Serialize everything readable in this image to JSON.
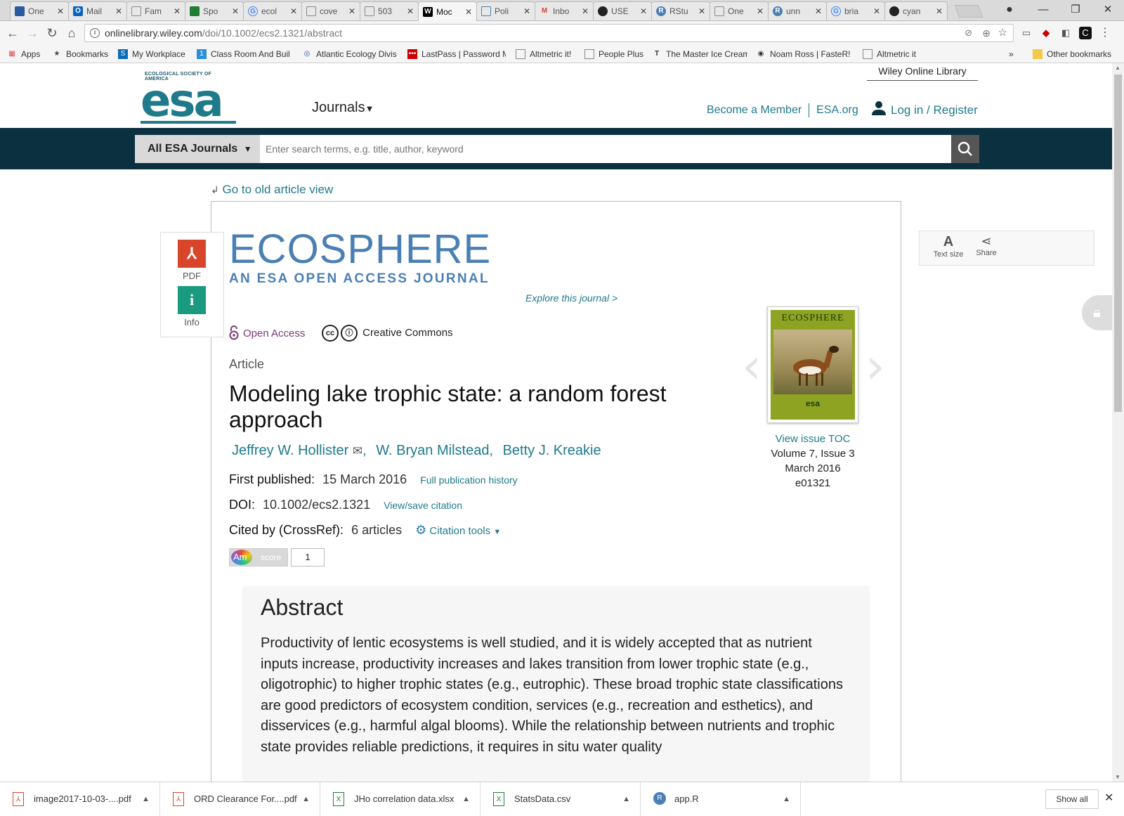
{
  "browser": {
    "tabs": [
      {
        "label": "One",
        "icon": "onedrive-icon",
        "color": "#2a5b9e"
      },
      {
        "label": "Mail",
        "icon": "outlook-icon",
        "color": "#0a64c2"
      },
      {
        "label": "Fam",
        "icon": "page-icon",
        "color": "#888888"
      },
      {
        "label": "Spo",
        "icon": "sheets-icon",
        "color": "#1e7e34"
      },
      {
        "label": "ecol",
        "icon": "google-icon",
        "color": "#4285f4"
      },
      {
        "label": "cove",
        "icon": "page-icon",
        "color": "#888888"
      },
      {
        "label": "503",
        "icon": "page-icon",
        "color": "#888888"
      },
      {
        "label": "Moc",
        "icon": "wiley-icon",
        "color": "#000000"
      },
      {
        "label": "Poli",
        "icon": "doc-icon",
        "color": "#4a7fb5"
      },
      {
        "label": "Inbo",
        "icon": "gmail-icon",
        "color": "#d44638"
      },
      {
        "label": "USE",
        "icon": "github-icon",
        "color": "#222222"
      },
      {
        "label": "RStu",
        "icon": "rstudio-icon",
        "color": "#4a7fb5"
      },
      {
        "label": "One",
        "icon": "page-icon",
        "color": "#888888"
      },
      {
        "label": "unn",
        "icon": "rstudio-icon",
        "color": "#4a7fb5"
      },
      {
        "label": "bria",
        "icon": "google-icon",
        "color": "#4285f4"
      },
      {
        "label": "cyan",
        "icon": "github-icon",
        "color": "#222222"
      }
    ],
    "tab_close": "✕",
    "window_controls": {
      "minimize": "—",
      "restore": "❐",
      "close": "✕"
    },
    "url_host": "onlinelibrary.wiley.com",
    "url_path": "/doi/10.1002/ecs2.1321/abstract",
    "bookmarks": [
      {
        "label": "Apps",
        "icon": "apps-grid-icon"
      },
      {
        "label": "Bookmarks",
        "icon": "star-icon"
      },
      {
        "label": "My Workplace",
        "icon": "sharepoint-icon"
      },
      {
        "label": "Class Room And Buil",
        "icon": "classroom-icon"
      },
      {
        "label": "Atlantic Ecology Divis",
        "icon": "epa-icon"
      },
      {
        "label": "LastPass | Password M",
        "icon": "lastpass-icon"
      },
      {
        "label": "Altmetric it!",
        "icon": "page-icon"
      },
      {
        "label": "People Plus",
        "icon": "page-icon"
      },
      {
        "label": "The Master Ice Cream",
        "icon": "nyt-icon"
      },
      {
        "label": "Noam Ross | FasteR!",
        "icon": "circle-icon"
      },
      {
        "label": "Altmetric it",
        "icon": "page-icon"
      }
    ],
    "bookmarks_overflow": "»",
    "other_bookmarks": "Other bookmarks"
  },
  "site": {
    "esa_small": "ECOLOGICAL SOCIETY OF AMERICA",
    "esa_logo": "esa",
    "wiley_link": "Wiley Online Library",
    "journals_menu": "Journals",
    "become_member": "Become a Member",
    "esa_org": "ESA.org",
    "login": "Log in / Register",
    "search_scope": "All ESA Journals",
    "search_placeholder": "Enter search terms, e.g. title, author, keyword",
    "colors": {
      "brand": "#1f7a8c",
      "dark_bar": "#0b3040",
      "journal_blue": "#4a7fb5",
      "open_access": "#7a3a78"
    }
  },
  "article": {
    "old_view": "Go to old article view",
    "tools": {
      "pdf": "PDF",
      "info": "Info",
      "text_size": "Text size",
      "share": "Share"
    },
    "journal_title": "ECOSPHERE",
    "journal_subtitle": "AN ESA OPEN ACCESS JOURNAL",
    "explore": "Explore this journal >",
    "open_access": "Open Access",
    "license": "Creative Commons",
    "type": "Article",
    "title": "Modeling lake trophic state: a random forest approach",
    "authors": [
      "Jeffrey W. Hollister",
      "W. Bryan Milstead,",
      "Betty J. Kreakie"
    ],
    "first_published_label": "First published:",
    "first_published": "15 March 2016",
    "pub_history": "Full publication history",
    "doi_label": "DOI:",
    "doi": "10.1002/ecs2.1321",
    "citation_link": "View/save citation",
    "cited_label": "Cited by (CrossRef):",
    "cited_count": "6 articles",
    "citation_tools": "Citation tools",
    "altmetric_label": "Am",
    "altmetric_score_label": "score",
    "altmetric_score": "1",
    "cover_title": "ECOSPHERE",
    "cover_logo": "esa",
    "toc_link": "View  issue TOC",
    "volume": "Volume 7, Issue 3",
    "issue_date": "March 2016",
    "article_number": "e01321",
    "abstract_heading": "Abstract",
    "abstract_text": "Productivity of lentic ecosystems is well studied, and it is widely accepted that as nutrient inputs increase, productivity increases and lakes transition from lower trophic state (e.g., oligotrophic) to higher trophic states (e.g., eutrophic). These broad trophic state classifications are good predictors of ecosystem condition, services (e.g., recreation and esthetics), and disservices (e.g., harmful algal blooms). While the relationship between nutrients and trophic state provides reliable predictions, it requires in situ water quality"
  },
  "downloads": {
    "items": [
      {
        "label": "image2017-10-03-....pdf",
        "icon": "pdf-file-icon"
      },
      {
        "label": "ORD Clearance For....pdf",
        "icon": "pdf-file-icon"
      },
      {
        "label": "JHo correlation data.xlsx",
        "icon": "excel-file-icon"
      },
      {
        "label": "StatsData.csv",
        "icon": "excel-file-icon"
      },
      {
        "label": "app.R",
        "icon": "r-file-icon"
      }
    ],
    "show_all": "Show all"
  }
}
